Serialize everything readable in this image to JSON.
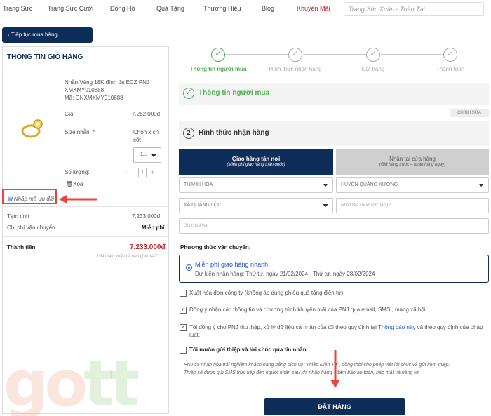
{
  "nav": {
    "items": [
      "Trang Sức",
      "Trang Sức Cưới",
      "Đồng Hồ",
      "Quà Tặng",
      "Thương Hiệu",
      "Blog",
      "Khuyến Mãi"
    ],
    "search_placeholder": "Trang Sức Xuân - Thần Tài"
  },
  "back_button": "Tiếp tục mua hàng",
  "cart": {
    "title": "THÔNG TIN GIỎ HÀNG",
    "product_name_1": "Nhẫn Vàng 18K đính đá ECZ PNJ",
    "product_name_2": "XMXMY010888",
    "product_code": "Mã: GNXMXMY010888",
    "price_label": "Giá:",
    "price": "7.262.000đ",
    "size_label": "Size nhẫn:",
    "size_required": "*",
    "size_choose_1": "Chọn kích",
    "size_choose_2": "cỡ:",
    "size_value": "1...",
    "qty_label": "Số lượng:",
    "qty_minus": "-",
    "qty_value": "1",
    "qty_plus": "+",
    "delete_label": "Xóa",
    "coupon_label": "Nhập mã ưu đãi",
    "subtotal_label": "Tạm tính",
    "subtotal": "7.233.000đ",
    "shipping_label": "Chi phí vận chuyển",
    "shipping": "Miễn phí",
    "total_label": "Thành tiền",
    "total": "7.233.000đ",
    "vat_note": "Giá tham khảo đã bao gồm VAT"
  },
  "steps": [
    "Thông tin người mua",
    "Hình thức nhận hàng",
    "Đặt hàng",
    "Thanh toán"
  ],
  "buyer_section": {
    "title": "Thông tin người mua",
    "edit": "CHỈNH SỬA"
  },
  "delivery_section": {
    "number": "2",
    "title": "Hình thức nhận hàng",
    "tab_home": "Giao hàng tận nơi",
    "tab_home_sub": "(Miễn phí giao hàng toàn quốc)",
    "tab_store": "Nhận tại cửa hàng",
    "tab_store_sub": "(Giữ hàng trước – nhận hàng ngay)",
    "province": "THANH HÓA",
    "district": "HUYỆN QUẢNG XƯƠNG",
    "ward": "XÃ QUẢNG LỘC",
    "address_placeholder": "Nhập Địa chỉ khách hàng *",
    "note_placeholder": "Ghi chú khác"
  },
  "shipping_method": {
    "title": "Phương thức vận chuyển:",
    "option": "Miễn phí giao hàng nhanh",
    "eta": "Dự kiến nhận hàng: Thứ tư, ngày 21/02/2024 - Thứ tư, ngày 28/02/2024"
  },
  "checks": {
    "invoice": "Xuất hóa đơn công ty (không áp dụng phiếu quà tặng điện tử)",
    "promo": "Đồng ý nhận các thông tin và chương trình khuyến mãi của PNJ qua email, SMS , mạng xã hội...",
    "privacy_1": "Tôi đồng ý cho PNJ thu thập, xử lý dữ liệu cá nhân của tôi theo quy định tại",
    "privacy_link": "Thông báo này",
    "privacy_2": "và theo quy định của pháp",
    "privacy_3": "luật.",
    "card": "Tôi muốn gửi thiệp và lời chúc qua tin nhắn",
    "card_note_1": "PNJ cá nhân hóa trải nghiệm khách hàng bằng dịch vụ \"Thiệp Điện Tử\", đồng thời cho phép viết lời chúc và gửi kèm thiệp.",
    "card_note_2": "Thiệp sẽ được gửi SMS trực tiếp đến người nhận sau khi nhận hàng - đảm bảo an toàn, bảo mật và riêng tư."
  },
  "order_button": "ĐẶT HÀNG",
  "watermark": {
    "g": "g",
    "o": "o",
    "t": "tt"
  },
  "colors": {
    "navy": "#0f2d59",
    "red": "#c0272d",
    "green": "#4caf50",
    "highlight": "#e8453c"
  }
}
